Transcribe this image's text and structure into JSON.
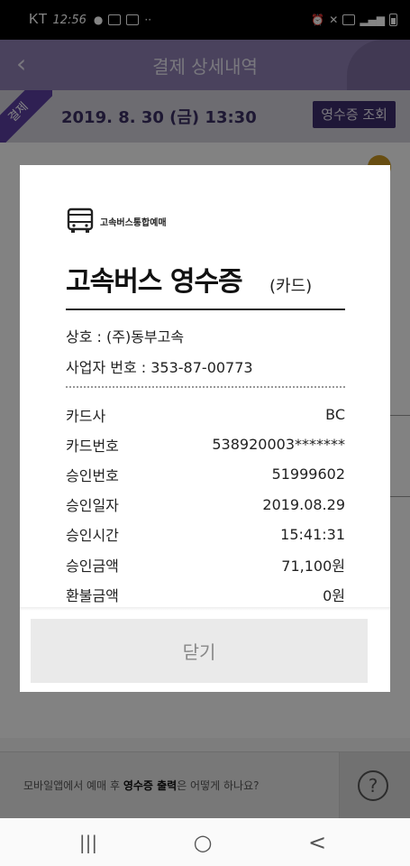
{
  "statusbar": {
    "carrier": "KT",
    "time": "12:56",
    "left_icons": [
      "notification-icon",
      "badge-icon",
      "wifi-call-icon",
      "image-icon",
      "more-icon"
    ],
    "right_icons": [
      "alarm-icon",
      "mute-icon",
      "hd-icon",
      "5g-icon",
      "signal-icon",
      "battery-icon"
    ]
  },
  "appbar": {
    "title": "결제 상세내역",
    "back_icon": "back-arrow-icon"
  },
  "dateband": {
    "ribbon": "결제",
    "date": "2019. 8. 30 (금) 13:30",
    "receipt_button": "영수증 조회"
  },
  "help": {
    "text_prefix": "모바일앱에서 예매 후 ",
    "text_bold": "영수증 출력",
    "text_suffix": "은 어떻게 하나요?",
    "question_mark": "?"
  },
  "nav": {
    "recents": "|||",
    "home": "○",
    "back": "<"
  },
  "receipt": {
    "logo_text": "고속버스통합예매",
    "title": "고속버스 영수증",
    "title_sub": "(카드)",
    "business_name": "상호 : (주)동부고속",
    "business_number": "사업자 번호 : 353-87-00773",
    "rows": [
      {
        "label": "카드사",
        "value": "BC"
      },
      {
        "label": "카드번호",
        "value": "538920003*******"
      },
      {
        "label": "승인번호",
        "value": "51999602"
      },
      {
        "label": "승인일자",
        "value": "2019.08.29"
      },
      {
        "label": "승인시간",
        "value": "15:41:31"
      },
      {
        "label": "승인금액",
        "value": "71,100원"
      },
      {
        "label": "환불금액",
        "value": "0원"
      }
    ],
    "close_label": "닫기"
  },
  "colors": {
    "appbar": "#8e7fb2",
    "ribbon": "#5b3fa0",
    "receipt_button": "#3d2c6b",
    "badge": "#c79624"
  }
}
